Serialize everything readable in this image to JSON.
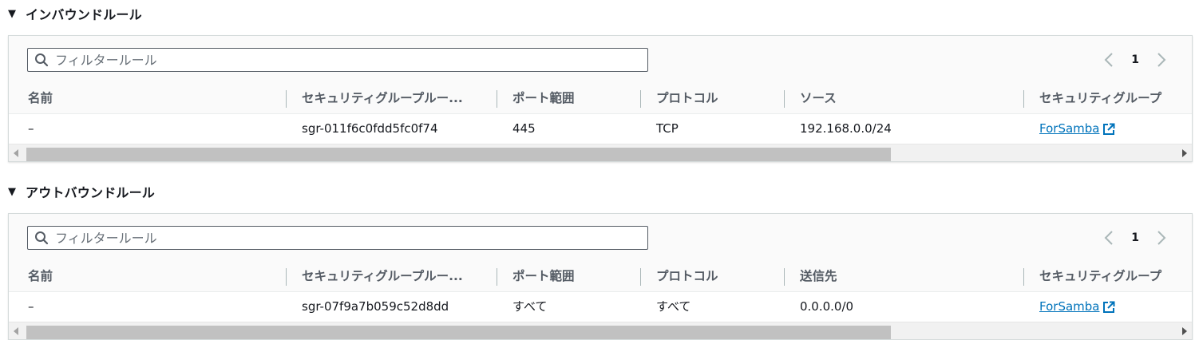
{
  "sections": [
    {
      "title": "インバウンドルール",
      "filter_placeholder": "フィルタールール",
      "page": "1",
      "columns": [
        "名前",
        "セキュリティグループルー...",
        "ポート範囲",
        "プロトコル",
        "ソース",
        "セキュリティグループ"
      ],
      "row": {
        "name": "–",
        "rule_id": "sgr-011f6c0fdd5fc0f74",
        "port_range": "445",
        "protocol": "TCP",
        "peer": "192.168.0.0/24",
        "security_group": "ForSamba"
      }
    },
    {
      "title": "アウトバウンドルール",
      "filter_placeholder": "フィルタールール",
      "page": "1",
      "columns": [
        "名前",
        "セキュリティグループルー...",
        "ポート範囲",
        "プロトコル",
        "送信先",
        "セキュリティグループ"
      ],
      "row": {
        "name": "–",
        "rule_id": "sgr-07f9a7b059c52d8dd",
        "port_range": "すべて",
        "protocol": "すべて",
        "peer": "0.0.0.0/0",
        "security_group": "ForSamba"
      }
    }
  ],
  "colors": {
    "link": "#0073bb",
    "header_text": "#545b64",
    "text": "#16191f"
  }
}
